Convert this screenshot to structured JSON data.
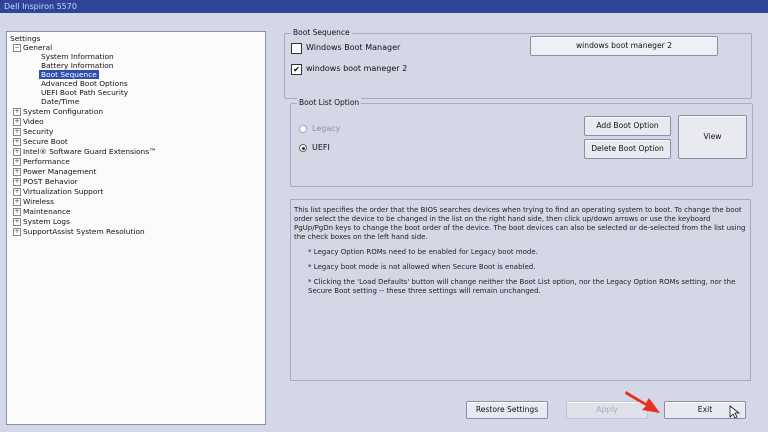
{
  "window": {
    "title": "Dell Inspiron 5570"
  },
  "tree": {
    "root": "Settings",
    "items": [
      {
        "label": "General",
        "expander": "−",
        "indent": 1
      },
      {
        "label": "System Information",
        "indent": 3
      },
      {
        "label": "Battery Information",
        "indent": 3
      },
      {
        "label": "Boot Sequence",
        "indent": 3,
        "selected": true
      },
      {
        "label": "Advanced Boot Options",
        "indent": 3
      },
      {
        "label": "UEFI Boot Path Security",
        "indent": 3
      },
      {
        "label": "Date/Time",
        "indent": 3
      },
      {
        "label": "System Configuration",
        "expander": "+",
        "indent": 1
      },
      {
        "label": "Video",
        "expander": "+",
        "indent": 1
      },
      {
        "label": "Security",
        "expander": "+",
        "indent": 1
      },
      {
        "label": "Secure Boot",
        "expander": "+",
        "indent": 1
      },
      {
        "label": "Intel® Software Guard Extensions™",
        "expander": "+",
        "indent": 1
      },
      {
        "label": "Performance",
        "expander": "+",
        "indent": 1
      },
      {
        "label": "Power Management",
        "expander": "+",
        "indent": 1
      },
      {
        "label": "POST Behavior",
        "expander": "+",
        "indent": 1
      },
      {
        "label": "Virtualization Support",
        "expander": "+",
        "indent": 1
      },
      {
        "label": "Wireless",
        "expander": "+",
        "indent": 1
      },
      {
        "label": "Maintenance",
        "expander": "+",
        "indent": 1
      },
      {
        "label": "System Logs",
        "expander": "+",
        "indent": 1
      },
      {
        "label": "SupportAssist System Resolution",
        "expander": "+",
        "indent": 1
      }
    ]
  },
  "boot_sequence": {
    "legend": "Boot Sequence",
    "entries": [
      {
        "label": "Windows Boot Manager",
        "checked": false
      },
      {
        "label": "windows boot maneger 2",
        "checked": true
      }
    ],
    "selected_entry_label": "windows boot maneger 2"
  },
  "boot_list_option": {
    "legend": "Boot List Option",
    "legacy_label": "Legacy",
    "uefi_label": "UEFI",
    "selected": "UEFI",
    "add_button": "Add Boot Option",
    "delete_button": "Delete Boot Option",
    "view_button": "View"
  },
  "description": {
    "paragraph": "This list specifies the order that the BIOS searches devices when trying to find an operating system to boot. To change the boot order select the device to be changed in the list on the right hand side, then click up/down arrows or use the keyboard PgUp/PgDn keys to change the boot order of the device. The boot devices can also be selected or de-selected from the list using the check boxes on the left hand side.",
    "note1": "* Legacy Option ROMs need to be enabled for Legacy boot mode.",
    "note2": "* Legacy boot mode is not allowed when Secure Boot is enabled.",
    "note3": "* Clicking the 'Load Defaults' button will change neither the Boot List option, nor the Legacy Option ROMs setting, nor the Secure Boot setting -- these three settings will remain unchanged."
  },
  "footer": {
    "restore_button": "Restore Settings",
    "apply_button": "Apply",
    "exit_button": "Exit"
  },
  "colors": {
    "selection": "#2f4fb0",
    "annotation_arrow": "#e5311e"
  }
}
